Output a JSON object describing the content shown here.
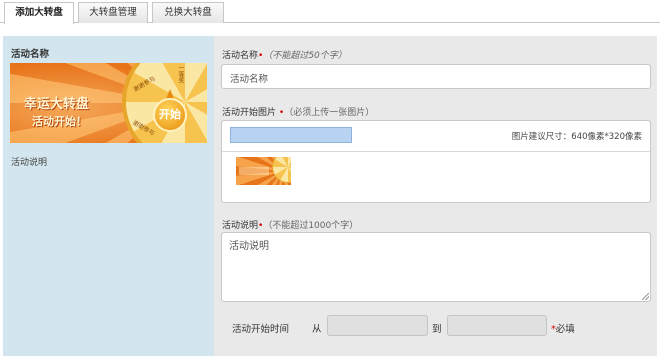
{
  "tabs": [
    {
      "label": "添加大转盘",
      "active": true
    },
    {
      "label": "大转盘管理",
      "active": false
    },
    {
      "label": "兑换大转盘",
      "active": false
    }
  ],
  "preview": {
    "title": "活动名称",
    "banner_line1": "幸运大转盘",
    "banner_line2": "活动开始！",
    "wheel_button": "开始",
    "wheel_labels": [
      "一等奖",
      "谢谢参与",
      "谢谢参与"
    ],
    "description": "活动说明"
  },
  "form": {
    "name_label": "活动名称",
    "name_required_mark": "•",
    "name_hint": "（不能超过50个字）",
    "name_value": "活动名称",
    "image_label": "活动开始图片",
    "image_required_mark": "•",
    "image_hint": "（必须上传一张图片）",
    "image_size_hint": "图片建议尺寸：640像素*320像素",
    "desc_label": "活动说明",
    "desc_required_mark": "•",
    "desc_hint": "（不能超过1000个字）",
    "desc_value": "活动说明",
    "time_label": "活动开始时间",
    "from_label": "从",
    "to_label": "到",
    "start_value": "",
    "end_value": "",
    "required_mark": "*",
    "required_text": "必填"
  },
  "colors": {
    "left_panel_bg": "#d3e6ef",
    "right_panel_bg": "#e9e9e9",
    "required_red": "#d40000",
    "file_bar_blue": "#b8d3f2"
  }
}
